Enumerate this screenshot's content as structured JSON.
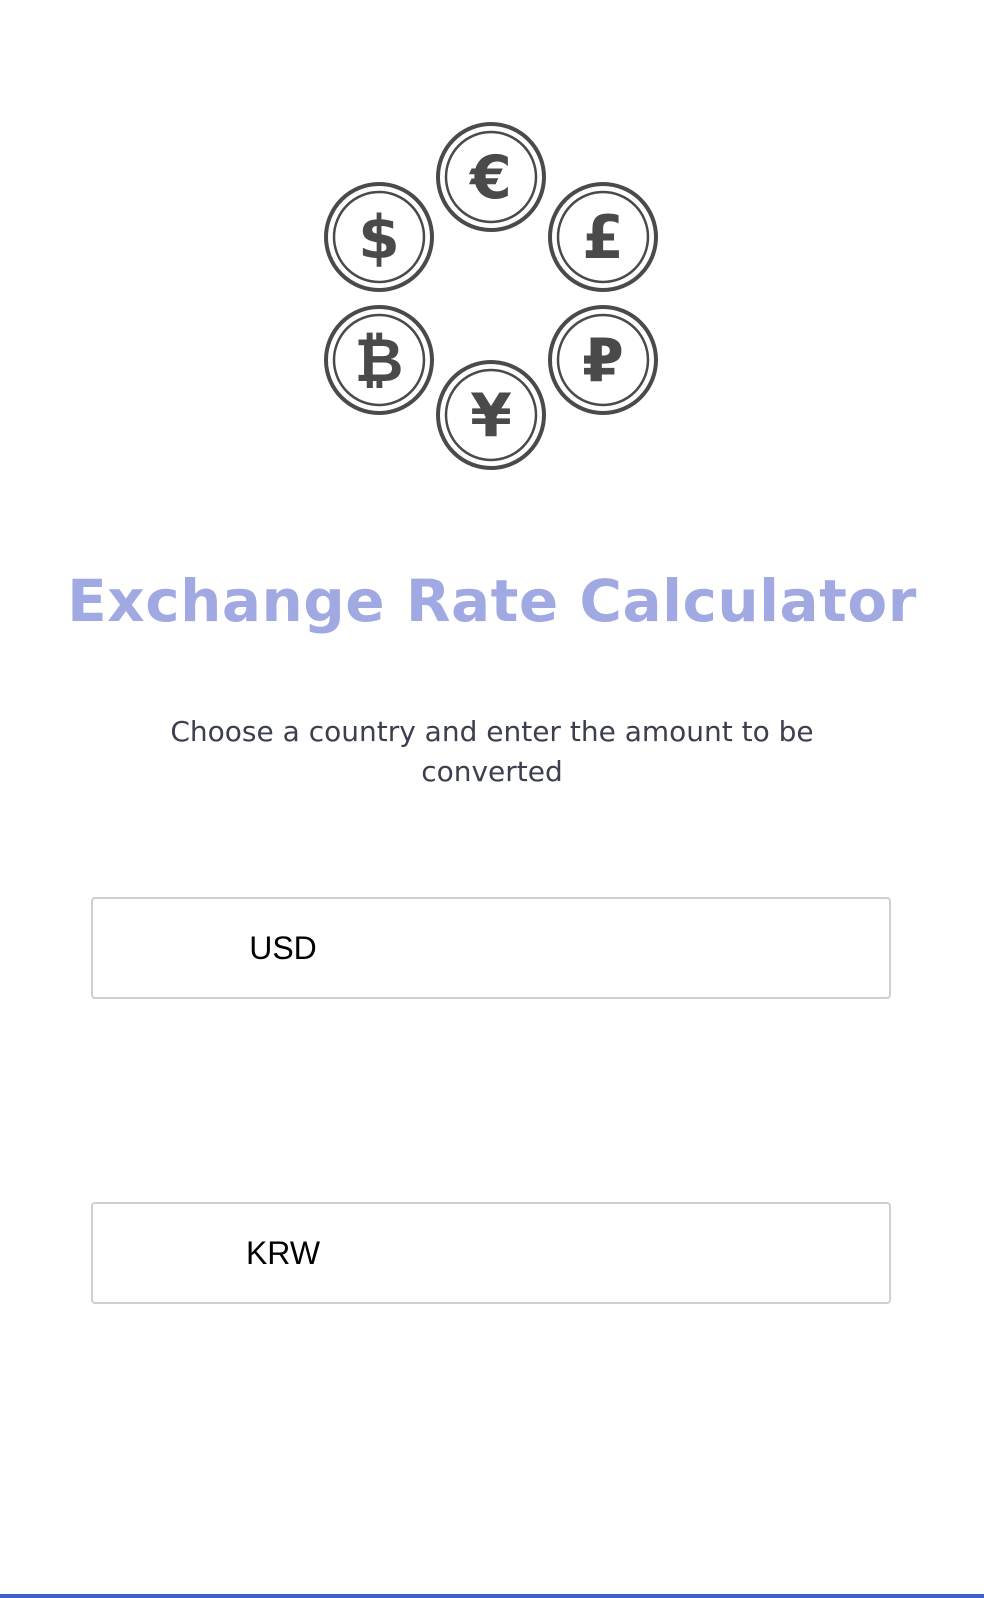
{
  "logo": {
    "coins": [
      {
        "name": "euro-coin-icon",
        "symbol": "€"
      },
      {
        "name": "dollar-coin-icon",
        "symbol": "$"
      },
      {
        "name": "pound-coin-icon",
        "symbol": "£"
      },
      {
        "name": "bitcoin-coin-icon",
        "symbol": "₿"
      },
      {
        "name": "ruble-coin-icon",
        "symbol": "₽"
      },
      {
        "name": "yen-coin-icon",
        "symbol": "¥"
      }
    ],
    "color": "#4a4a4a"
  },
  "header": {
    "title": "Exchange Rate Calculator",
    "subtitle": "Choose a country and enter the amount to be converted"
  },
  "converter": {
    "from": {
      "currency": "USD",
      "amount": ""
    },
    "to": {
      "currency": "KRW",
      "amount": ""
    }
  },
  "colors": {
    "title": "#a0a9e1",
    "subtitle": "#3c3f4d",
    "border": "#cfcfcf",
    "accent_bar": "#3a62c9"
  }
}
